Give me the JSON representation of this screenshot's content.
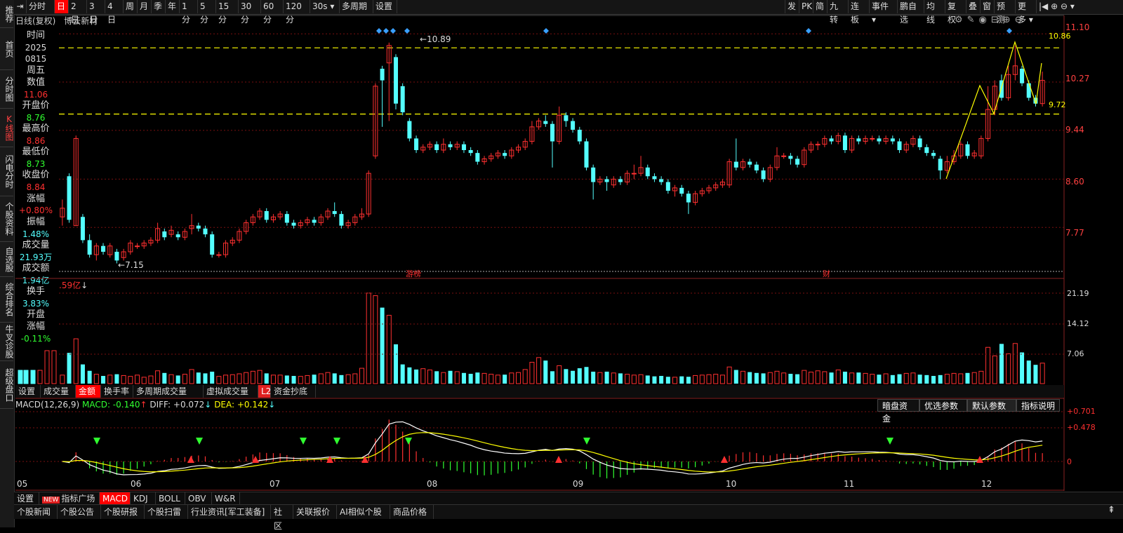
{
  "leftnav": [
    "推荐",
    "首页",
    "分时图",
    "K线图",
    "闪电分时",
    "个股资料",
    "自选股",
    "综合排名",
    "牛叉诊股",
    "超级盘口"
  ],
  "toolbar": {
    "left": [
      "分时",
      "日",
      "2日",
      "3日",
      "4日",
      "周",
      "月",
      "季",
      "年",
      "1分",
      "5分",
      "15分",
      "30分",
      "60分",
      "120分",
      "30s",
      "多周期",
      "设置"
    ],
    "active": "日",
    "right": [
      "发",
      "PK",
      "简",
      "九转",
      "连板",
      "事件",
      "鹏自选",
      "均线",
      "复权",
      "叠",
      "窗",
      "预测",
      "更多"
    ]
  },
  "chart_header": {
    "period": "日线(复权)",
    "name": "博云新材"
  },
  "info": {
    "time_label": "时间",
    "date_year": "2025",
    "date_md": "0815",
    "weekday": "周五",
    "value_label": "数值",
    "value": "11.06",
    "open_label": "开盘价",
    "open": "8.76",
    "high_label": "最高价",
    "high": "8.86",
    "low_label": "最低价",
    "low": "8.73",
    "close_label": "收盘价",
    "close": "8.84",
    "chg_label": "涨幅",
    "chg": "+0.80%",
    "amp_label": "振幅",
    "amp": "1.48%",
    "vol_label": "成交量",
    "vol": "21.93万",
    "amt_label": "成交额",
    "amt": "1.94亿",
    "turn_label": "换手",
    "turn": "3.83%",
    "open_chg_label1": "开盘",
    "open_chg_label2": "涨幅",
    "open_chg": "-0.11%"
  },
  "price_axis": [
    "11.10",
    "10.27",
    "9.44",
    "8.60",
    "7.77"
  ],
  "annotations": {
    "high": "10.89",
    "low": "7.15",
    "right_high": "10.86",
    "right_low": "9.72",
    "tag1": "游榜",
    "tag2": "财"
  },
  "vol_axis": [
    "21.19",
    "14.12",
    "7.06"
  ],
  "vol_header": ".59亿",
  "vol_tabs": [
    "设置",
    "成交量",
    "金额",
    "换手率",
    "多周期成交量",
    "虚拟成交量",
    "资金抄底"
  ],
  "vol_tab_active": "金额",
  "vol_tab_badge": "L2",
  "macd_header": {
    "name": "MACD(12,26,9)",
    "macd": "MACD: -0.140",
    "diff": "DIFF: +0.072",
    "dea": "DEA: +0.142"
  },
  "macd_buttons": [
    "暗盘资金",
    "优选参数",
    "默认参数",
    "指标说明"
  ],
  "macd_active": "默认参数",
  "macd_axis": [
    "+0.701",
    "+0.478",
    "0"
  ],
  "months": [
    "05",
    "06",
    "07",
    "08",
    "09",
    "10",
    "11",
    "12"
  ],
  "indicator_tabs": [
    "设置",
    "指标广场",
    "MACD",
    "KDJ",
    "BOLL",
    "OBV",
    "W&R"
  ],
  "indicator_new": "NEW",
  "indicator_active": "MACD",
  "news_tabs": [
    "个股新闻",
    "个股公告",
    "个股研报",
    "个股扫雷",
    "行业资讯[军工装备]",
    "社区",
    "关联报价",
    "AI相似个股",
    "商品价格"
  ],
  "colors": {
    "up": "#ff3030",
    "down": "#54ffff",
    "yellow": "#ffff00",
    "bg": "#000000"
  },
  "chart_data": {
    "type": "candlestick",
    "ylim": [
      7.0,
      11.2
    ],
    "candles": [
      [
        7.95,
        8.1,
        8.25,
        7.8
      ],
      [
        8.65,
        7.9,
        8.7,
        7.85
      ],
      [
        7.8,
        9.3,
        9.35,
        7.8
      ],
      [
        7.95,
        7.55,
        8.0,
        7.5
      ],
      [
        7.55,
        7.3,
        7.65,
        7.25
      ],
      [
        7.3,
        7.45,
        7.5,
        7.2
      ],
      [
        7.45,
        7.35,
        7.5,
        7.3
      ],
      [
        7.3,
        7.45,
        7.5,
        7.25
      ],
      [
        7.35,
        7.2,
        7.4,
        7.15
      ],
      [
        7.25,
        7.35,
        7.4,
        7.2
      ],
      [
        7.35,
        7.5,
        7.55,
        7.3
      ],
      [
        7.45,
        7.45,
        7.5,
        7.4
      ],
      [
        7.45,
        7.5,
        7.55,
        7.4
      ],
      [
        7.5,
        7.55,
        7.6,
        7.45
      ],
      [
        7.55,
        7.75,
        7.85,
        7.5
      ],
      [
        7.7,
        7.6,
        7.75,
        7.55
      ],
      [
        7.65,
        7.72,
        7.8,
        7.6
      ],
      [
        7.65,
        7.6,
        7.7,
        7.55
      ],
      [
        7.6,
        7.7,
        7.75,
        7.55
      ],
      [
        7.75,
        7.8,
        8.0,
        7.65
      ],
      [
        7.8,
        7.75,
        7.85,
        7.7
      ],
      [
        7.75,
        7.65,
        7.8,
        7.6
      ],
      [
        7.65,
        7.3,
        7.7,
        7.25
      ],
      [
        7.3,
        7.3,
        7.35,
        7.25
      ],
      [
        7.3,
        7.5,
        7.55,
        7.25
      ],
      [
        7.5,
        7.55,
        7.6,
        7.45
      ],
      [
        7.55,
        7.7,
        7.75,
        7.5
      ],
      [
        7.7,
        7.85,
        7.9,
        7.65
      ],
      [
        7.85,
        7.95,
        8.0,
        7.8
      ],
      [
        7.95,
        8.05,
        8.1,
        7.9
      ],
      [
        8.05,
        7.9,
        8.1,
        7.85
      ],
      [
        7.9,
        7.95,
        8.0,
        7.85
      ],
      [
        7.95,
        8.0,
        8.05,
        7.9
      ],
      [
        8.0,
        7.85,
        8.05,
        7.8
      ],
      [
        7.85,
        7.8,
        7.9,
        7.75
      ],
      [
        7.8,
        7.85,
        7.9,
        7.75
      ],
      [
        7.85,
        7.9,
        7.95,
        7.8
      ],
      [
        7.9,
        7.85,
        7.95,
        7.8
      ],
      [
        7.85,
        7.95,
        8.0,
        7.8
      ],
      [
        7.95,
        8.05,
        8.1,
        7.9
      ],
      [
        8.05,
        8.0,
        8.2,
        7.95
      ],
      [
        8.0,
        7.8,
        8.05,
        7.75
      ],
      [
        7.8,
        7.85,
        7.9,
        7.75
      ],
      [
        7.85,
        7.95,
        8.0,
        7.8
      ],
      [
        7.95,
        8.0,
        8.1,
        7.9
      ],
      [
        8.0,
        8.7,
        8.75,
        7.95
      ],
      [
        9.0,
        10.2,
        10.25,
        8.95
      ],
      [
        10.5,
        10.3,
        10.55,
        9.5
      ],
      [
        10.6,
        10.9,
        10.95,
        9.6
      ],
      [
        10.7,
        9.9,
        10.75,
        9.8
      ],
      [
        10.2,
        9.75,
        10.25,
        9.7
      ],
      [
        9.6,
        9.3,
        9.65,
        9.25
      ],
      [
        9.3,
        9.1,
        9.35,
        9.05
      ],
      [
        9.1,
        9.15,
        9.2,
        9.05
      ],
      [
        9.15,
        9.2,
        9.25,
        9.1
      ],
      [
        9.2,
        9.1,
        9.25,
        9.05
      ],
      [
        9.1,
        9.2,
        9.3,
        9.05
      ],
      [
        9.2,
        9.15,
        9.25,
        9.1
      ],
      [
        9.15,
        9.2,
        9.25,
        9.1
      ],
      [
        9.2,
        9.1,
        9.25,
        9.05
      ],
      [
        9.1,
        9.05,
        9.15,
        9.0
      ],
      [
        9.05,
        8.9,
        9.1,
        8.85
      ],
      [
        8.9,
        8.95,
        9.0,
        8.85
      ],
      [
        8.95,
        9.0,
        9.05,
        8.9
      ],
      [
        9.0,
        9.05,
        9.1,
        8.95
      ],
      [
        9.05,
        9.0,
        9.1,
        8.95
      ],
      [
        9.0,
        9.1,
        9.15,
        8.95
      ],
      [
        9.1,
        9.15,
        9.2,
        9.05
      ],
      [
        9.15,
        9.25,
        9.3,
        9.1
      ],
      [
        9.25,
        9.5,
        9.6,
        9.2
      ],
      [
        9.5,
        9.6,
        9.65,
        9.45
      ],
      [
        9.6,
        9.55,
        9.7,
        9.5
      ],
      [
        9.55,
        9.25,
        9.6,
        8.8
      ],
      [
        9.25,
        9.7,
        9.85,
        9.2
      ],
      [
        9.7,
        9.6,
        9.75,
        9.5
      ],
      [
        9.6,
        9.45,
        9.65,
        9.4
      ],
      [
        9.45,
        9.25,
        9.5,
        9.2
      ],
      [
        9.25,
        8.8,
        9.3,
        8.75
      ],
      [
        8.8,
        8.55,
        8.85,
        8.25
      ],
      [
        8.55,
        8.6,
        8.65,
        8.5
      ],
      [
        8.6,
        8.55,
        8.65,
        8.4
      ],
      [
        8.5,
        8.6,
        8.65,
        8.45
      ],
      [
        8.6,
        8.55,
        8.65,
        8.5
      ],
      [
        8.55,
        8.7,
        8.75,
        8.5
      ],
      [
        8.7,
        8.7,
        8.85,
        8.6
      ],
      [
        8.7,
        8.8,
        9.0,
        8.65
      ],
      [
        8.8,
        8.65,
        8.85,
        8.6
      ],
      [
        8.65,
        8.6,
        8.7,
        8.55
      ],
      [
        8.6,
        8.55,
        8.65,
        8.5
      ],
      [
        8.55,
        8.4,
        8.6,
        8.35
      ],
      [
        8.4,
        8.45,
        8.5,
        8.3
      ],
      [
        8.45,
        8.35,
        8.5,
        8.3
      ],
      [
        8.35,
        8.2,
        8.4,
        8.0
      ],
      [
        8.2,
        8.35,
        8.4,
        8.15
      ],
      [
        8.35,
        8.4,
        8.45,
        8.3
      ],
      [
        8.4,
        8.45,
        8.5,
        8.35
      ],
      [
        8.45,
        8.5,
        8.55,
        8.4
      ],
      [
        8.5,
        8.55,
        8.6,
        8.45
      ],
      [
        8.5,
        8.9,
        8.95,
        8.45
      ],
      [
        8.9,
        8.8,
        9.3,
        8.75
      ],
      [
        8.8,
        8.9,
        8.95,
        8.75
      ],
      [
        8.9,
        8.85,
        8.95,
        8.8
      ],
      [
        8.85,
        8.75,
        8.9,
        8.7
      ],
      [
        8.75,
        8.6,
        8.8,
        8.55
      ],
      [
        8.6,
        8.8,
        8.85,
        8.55
      ],
      [
        8.8,
        9.0,
        9.15,
        8.75
      ],
      [
        9.0,
        9.0,
        9.05,
        8.95
      ],
      [
        9.0,
        8.95,
        9.05,
        8.85
      ],
      [
        8.95,
        8.85,
        9.0,
        8.8
      ],
      [
        8.85,
        9.1,
        9.15,
        8.8
      ],
      [
        9.1,
        9.2,
        9.25,
        9.05
      ],
      [
        9.2,
        9.2,
        9.25,
        9.1
      ],
      [
        9.2,
        9.3,
        9.35,
        9.15
      ],
      [
        9.3,
        9.25,
        9.35,
        9.2
      ],
      [
        9.25,
        9.35,
        9.4,
        9.2
      ],
      [
        9.35,
        9.1,
        9.4,
        9.05
      ],
      [
        9.1,
        9.3,
        9.35,
        9.05
      ],
      [
        9.3,
        9.25,
        9.35,
        9.2
      ],
      [
        9.25,
        9.3,
        9.35,
        9.2
      ],
      [
        9.3,
        9.3,
        9.35,
        9.25
      ],
      [
        9.3,
        9.25,
        9.35,
        9.2
      ],
      [
        9.25,
        9.3,
        9.35,
        9.2
      ],
      [
        9.3,
        9.25,
        9.35,
        9.2
      ],
      [
        9.25,
        9.1,
        9.3,
        9.05
      ],
      [
        9.1,
        9.2,
        9.25,
        9.05
      ],
      [
        9.2,
        9.3,
        9.35,
        9.15
      ],
      [
        9.3,
        9.15,
        9.35,
        9.1
      ],
      [
        9.15,
        9.05,
        9.2,
        9.0
      ],
      [
        9.05,
        9.0,
        9.1,
        8.95
      ],
      [
        8.95,
        8.75,
        9.0,
        8.6
      ],
      [
        8.75,
        8.9,
        9.0,
        8.7
      ],
      [
        8.9,
        9.0,
        9.1,
        8.85
      ],
      [
        9.0,
        9.2,
        9.25,
        8.95
      ],
      [
        9.2,
        9.0,
        9.25,
        8.95
      ],
      [
        9.0,
        9.05,
        9.1,
        8.95
      ],
      [
        9.0,
        9.3,
        9.35,
        8.95
      ],
      [
        9.3,
        9.8,
        10.2,
        9.25
      ],
      [
        9.8,
        10.2,
        10.3,
        9.7
      ],
      [
        10.3,
        10.0,
        10.4,
        9.95
      ],
      [
        10.0,
        10.4,
        10.55,
        9.95
      ],
      [
        10.4,
        10.55,
        10.9,
        10.3
      ],
      [
        10.5,
        10.25,
        10.55,
        10.2
      ],
      [
        10.25,
        10.0,
        10.3,
        9.95
      ],
      [
        10.0,
        9.9,
        10.05,
        9.85
      ],
      [
        9.9,
        10.3,
        10.45,
        9.85
      ]
    ],
    "volume": [
      2.0,
      7.2,
      10.5,
      4.5,
      3.0,
      2.2,
      1.8,
      2.0,
      2.2,
      1.9,
      1.7,
      2.0,
      1.5,
      1.8,
      3.0,
      2.5,
      2.1,
      1.9,
      2.2,
      3.3,
      2.6,
      2.4,
      2.8,
      1.7,
      2.0,
      2.1,
      2.3,
      2.6,
      2.9,
      3.1,
      2.4,
      2.0,
      2.0,
      1.9,
      1.8,
      1.7,
      1.9,
      2.1,
      2.3,
      2.6,
      2.4,
      2.0,
      2.1,
      2.3,
      3.6,
      21.2,
      20.6,
      17.8,
      16.0,
      9.2,
      4.5,
      3.8,
      3.3,
      3.5,
      3.2,
      2.9,
      2.6,
      3.0,
      2.8,
      2.5,
      2.3,
      2.6,
      2.4,
      2.2,
      2.0,
      2.1,
      2.5,
      2.6,
      3.3,
      5.0,
      6.1,
      5.4,
      2.9,
      4.2,
      3.4,
      3.0,
      3.6,
      3.9,
      2.8,
      2.6,
      2.8,
      2.5,
      2.4,
      2.2,
      2.0,
      2.1,
      1.9,
      1.7,
      1.8,
      1.6,
      1.5,
      1.7,
      1.6,
      1.9,
      2.0,
      2.1,
      2.2,
      2.0,
      3.9,
      3.2,
      2.9,
      2.7,
      2.5,
      2.4,
      2.6,
      2.9,
      2.5,
      2.3,
      2.2,
      3.1,
      2.7,
      3.0,
      2.8,
      2.6,
      3.2,
      2.8,
      2.5,
      2.6,
      2.4,
      2.2,
      2.1,
      2.3,
      2.0,
      2.2,
      2.4,
      2.5,
      2.1,
      2.0,
      1.8,
      2.0,
      2.2,
      2.4,
      2.3,
      2.5,
      2.6,
      2.9,
      8.5,
      6.5,
      9.3,
      7.0,
      9.4,
      7.3,
      5.4,
      4.4,
      4.8
    ]
  }
}
